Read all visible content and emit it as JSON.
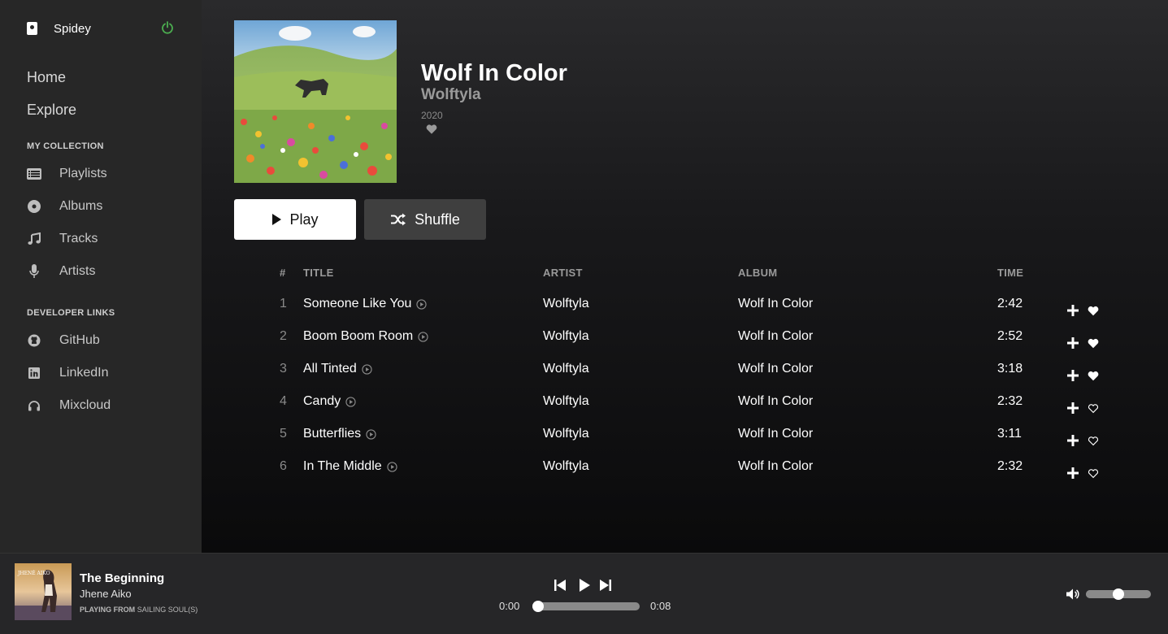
{
  "sidebar": {
    "brand": {
      "name": "Spidey",
      "icon": "app-icon",
      "power_icon": "power-icon",
      "power_color": "#4caf50"
    },
    "main_links": [
      {
        "label": "Home"
      },
      {
        "label": "Explore"
      }
    ],
    "collection_title": "MY COLLECTION",
    "collection": [
      {
        "label": "Playlists",
        "icon": "list-icon"
      },
      {
        "label": "Albums",
        "icon": "disc-icon"
      },
      {
        "label": "Tracks",
        "icon": "music-note-icon"
      },
      {
        "label": "Artists",
        "icon": "microphone-icon"
      }
    ],
    "developer_title": "DEVELOPER LINKS",
    "developer": [
      {
        "label": "GitHub",
        "icon": "github-icon"
      },
      {
        "label": "LinkedIn",
        "icon": "linkedin-icon"
      },
      {
        "label": "Mixcloud",
        "icon": "headphones-icon"
      }
    ]
  },
  "album": {
    "title": "Wolf In Color",
    "artist": "Wolftyla",
    "year": "2020",
    "liked": false,
    "play_label": "Play",
    "shuffle_label": "Shuffle"
  },
  "table": {
    "headers": {
      "num": "#",
      "title": "TITLE",
      "artist": "ARTIST",
      "album": "ALBUM",
      "time": "TIME"
    },
    "rows": [
      {
        "num": "1",
        "title": "Someone Like You",
        "artist": "Wolftyla",
        "album": "Wolf In Color",
        "time": "2:42",
        "liked": true
      },
      {
        "num": "2",
        "title": "Boom Boom Room",
        "artist": "Wolftyla",
        "album": "Wolf In Color",
        "time": "2:52",
        "liked": true
      },
      {
        "num": "3",
        "title": "All Tinted",
        "artist": "Wolftyla",
        "album": "Wolf In Color",
        "time": "3:18",
        "liked": true
      },
      {
        "num": "4",
        "title": "Candy",
        "artist": "Wolftyla",
        "album": "Wolf In Color",
        "time": "2:32",
        "liked": false
      },
      {
        "num": "5",
        "title": "Butterflies",
        "artist": "Wolftyla",
        "album": "Wolf In Color",
        "time": "3:11",
        "liked": false
      },
      {
        "num": "6",
        "title": "In The Middle",
        "artist": "Wolftyla",
        "album": "Wolf In Color",
        "time": "2:32",
        "liked": false
      }
    ]
  },
  "player": {
    "title": "The Beginning",
    "artist": "Jhene Aiko",
    "from_label": "PLAYING FROM",
    "from_source": "SAILING SOUL(S)",
    "current_time": "0:00",
    "duration": "0:08",
    "progress": 0,
    "volume": 0.5
  },
  "colors": {
    "sidebar_bg": "#272727",
    "player_bg": "#262628",
    "accent_power": "#4caf50"
  }
}
